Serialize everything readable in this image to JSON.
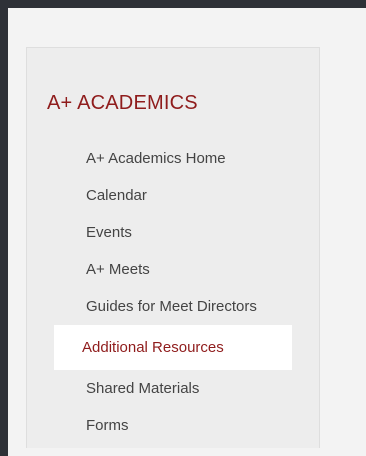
{
  "sidebar": {
    "title": "A+ ACADEMICS",
    "items": [
      {
        "label": "A+ Academics Home"
      },
      {
        "label": "Calendar"
      },
      {
        "label": "Events"
      },
      {
        "label": "A+ Meets"
      },
      {
        "label": "Guides for Meet Directors"
      },
      {
        "label": "Additional Resources",
        "active": true
      },
      {
        "label": "Shared Materials"
      },
      {
        "label": "Forms"
      }
    ]
  },
  "colors": {
    "accent": "#8f1c1c",
    "frame": "#2e3137",
    "page": "#f3f3f3",
    "card": "#ededed"
  }
}
